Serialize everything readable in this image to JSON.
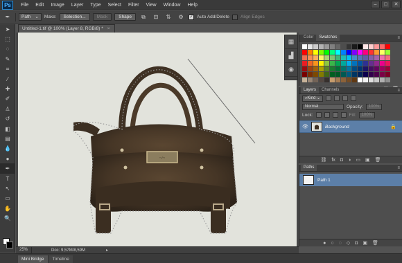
{
  "app": {
    "logo": "Ps"
  },
  "menu": [
    "File",
    "Edit",
    "Image",
    "Layer",
    "Type",
    "Select",
    "Filter",
    "View",
    "Window",
    "Help"
  ],
  "window_controls": [
    "–",
    "□",
    "✕"
  ],
  "options_bar": {
    "mode_value": "Path",
    "make_label": "Make:",
    "selection_button": "Selection...",
    "mask_button": "Mask",
    "shape_button": "Shape",
    "auto_add_delete_label": "Auto Add/Delete",
    "auto_add_delete_checked": true,
    "align_edges_label": "Align Edges",
    "align_edges_checked": false
  },
  "document": {
    "tab_title": "Untitled-1.tif @ 100% (Layer 8, RGB/8) *",
    "zoom": "25%",
    "doc_info": "Doc: 9,57M/8,59M",
    "canvas_bg": "#e2e3dc"
  },
  "bottom_tabs": [
    "Mini Bridge",
    "Timeline"
  ],
  "colors": {
    "foreground": "#ffffff",
    "background": "#000000",
    "selection": "#5c7fa8"
  },
  "panels": {
    "swatches": {
      "tabs": [
        "Color",
        "Swatches"
      ],
      "active": "Swatches"
    },
    "layers": {
      "tabs": [
        "Layers",
        "Channels"
      ],
      "filter_kind": "Kind",
      "blend_mode": "Normal",
      "opacity_label": "Opacity:",
      "opacity_value": "100%",
      "lock_label": "Lock:",
      "fill_label": "Fill:",
      "fill_value": "100%",
      "layer_name": "Background"
    },
    "paths": {
      "tabs": [
        "Paths"
      ],
      "path_name": "Path 1"
    }
  },
  "swatch_colors": [
    "#ffffff",
    "#e6e6e6",
    "#cccccc",
    "#b3b3b3",
    "#999999",
    "#808080",
    "#666666",
    "#4d4d4d",
    "#333333",
    "#1a1a1a",
    "#000000",
    "#ffe6e6",
    "#ffcccc",
    "#ff9999",
    "#ff6666",
    "#ff0000",
    "#ff0000",
    "#ff8000",
    "#ffff00",
    "#80ff00",
    "#00ff00",
    "#00ff80",
    "#00ffff",
    "#0080ff",
    "#0000ff",
    "#8000ff",
    "#ff00ff",
    "#ff0080",
    "#ff3333",
    "#ff9933",
    "#ffff66",
    "#99ff33",
    "#f26c4f",
    "#f68e56",
    "#fbaf5c",
    "#fff467",
    "#acd372",
    "#7dc473",
    "#3cb878",
    "#1cbbb4",
    "#00bff3",
    "#438ccb",
    "#5574b9",
    "#605ca8",
    "#855fa8",
    "#a763a8",
    "#f06eaa",
    "#f26d7d",
    "#ed1c24",
    "#f26522",
    "#f7941d",
    "#fff200",
    "#8dc63f",
    "#39b54a",
    "#00a651",
    "#00a99d",
    "#00aeef",
    "#0072bc",
    "#0054a6",
    "#2e3192",
    "#662d91",
    "#92278f",
    "#ec008c",
    "#ed145b",
    "#9e0b0f",
    "#a0410d",
    "#a36209",
    "#aba000",
    "#598527",
    "#1a7b30",
    "#007236",
    "#00746b",
    "#0076a3",
    "#004a80",
    "#003471",
    "#1b1464",
    "#440e62",
    "#630460",
    "#9e005d",
    "#9e0039",
    "#790000",
    "#7b2e00",
    "#7d4900",
    "#827b00",
    "#406618",
    "#005e20",
    "#005826",
    "#005952",
    "#005b7f",
    "#003663",
    "#002157",
    "#0d004c",
    "#32004b",
    "#4b0049",
    "#7b0046",
    "#7a0026",
    "#c7b299",
    "#998675",
    "#736357",
    "#534741",
    "#37302d",
    "#c69c6d",
    "#a67c52",
    "#8c6239",
    "#754c24",
    "#603913",
    "#ffffff",
    "#f2f2f2",
    "#e0e0e0",
    "#c9c9c9",
    "#b0b0b0",
    "#8f8f8f"
  ]
}
